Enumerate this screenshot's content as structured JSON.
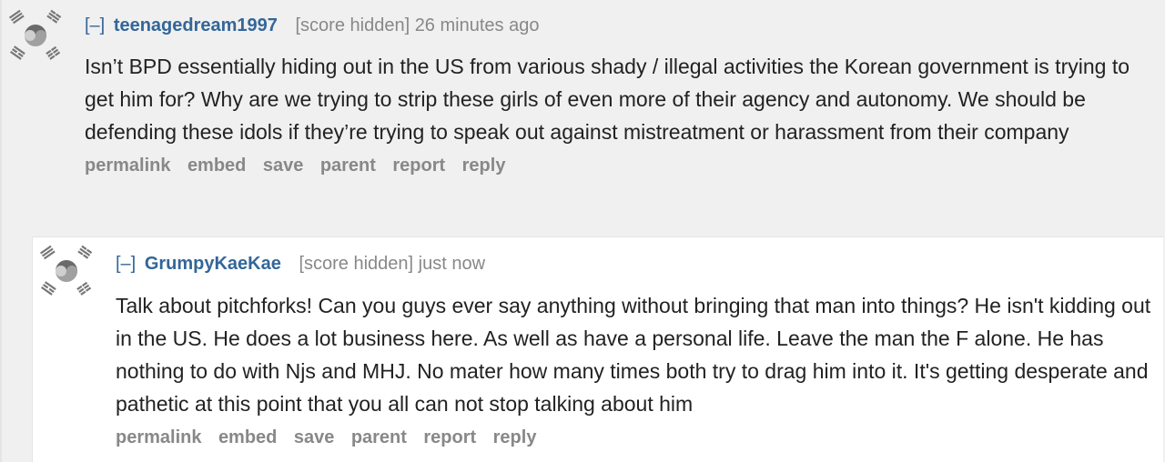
{
  "comments": [
    {
      "collapse": "[–]",
      "author": "teenagedream1997",
      "score": "[score hidden]",
      "time": "26 minutes ago",
      "text": "Isn’t BPD essentially hiding out in the US from various shady / illegal activities the Korean government is trying to get him for? Why are we trying to strip these girls of even more of their agency and autonomy. We should be defending these idols if they’re trying to speak out against mistreatment or harassment from their company",
      "buttons": [
        "permalink",
        "embed",
        "save",
        "parent",
        "report",
        "reply"
      ]
    },
    {
      "collapse": "[–]",
      "author": "GrumpyKaeKae",
      "score": "[score hidden]",
      "time": "just now",
      "text": "Talk about pitchforks! Can you guys ever say anything without bringing that man into things? He isn't kidding out in the US. He does a lot business here. As well as have a personal life. Leave the man the F alone. He has nothing to do with Njs and MHJ. No mater how many times both try to drag him into it. It's getting desperate and pathetic at this point that you all can not stop talking about him",
      "buttons": [
        "permalink",
        "embed",
        "save",
        "parent",
        "report",
        "reply"
      ]
    }
  ],
  "icons": {
    "avatar": "taegukgi-flag-avatar-icon"
  },
  "colors": {
    "author": "#336699",
    "meta": "#888888",
    "text": "#222222",
    "parent_bg": "#f0f0f0",
    "child_bg": "#ffffff"
  }
}
